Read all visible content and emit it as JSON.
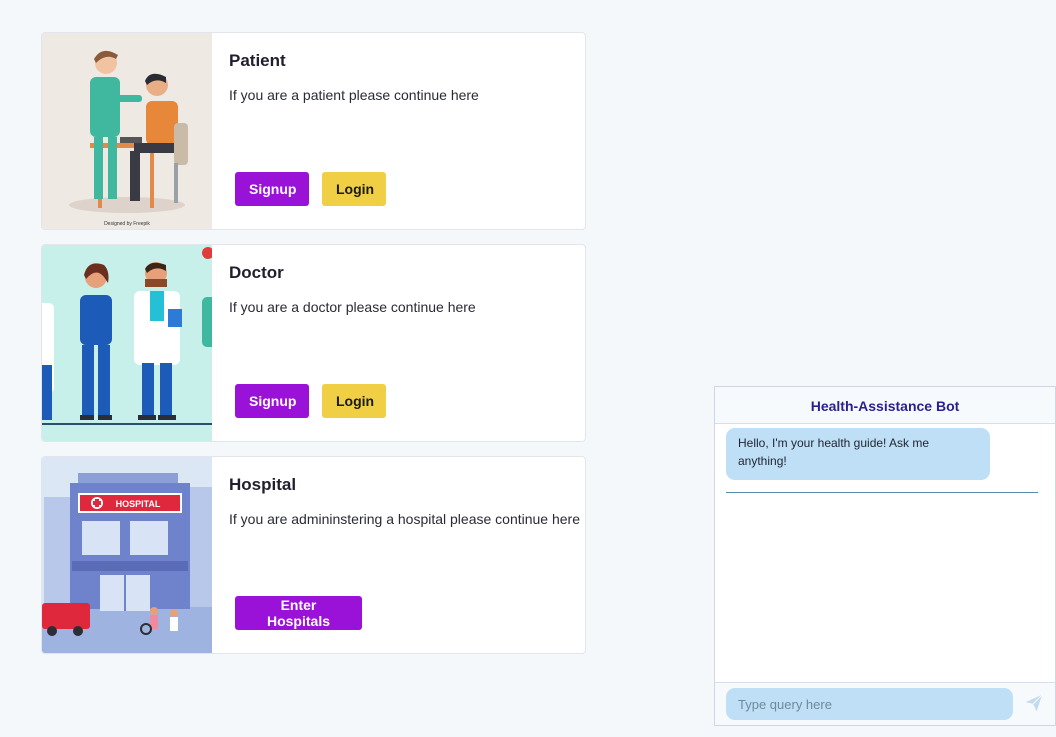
{
  "cards": [
    {
      "title": "Patient",
      "description": "If you are a patient please continue here",
      "buttons": {
        "signup": "Signup",
        "login": "Login"
      },
      "image_credit": "Designed by Freepik"
    },
    {
      "title": "Doctor",
      "description": "If you are a doctor please continue here",
      "buttons": {
        "signup": "Signup",
        "login": "Login"
      }
    },
    {
      "title": "Hospital",
      "description": "If you are admininstering a hospital please continue here",
      "buttons": {
        "enter": "Enter Hospitals"
      },
      "image_sign": "HOSPITAL"
    }
  ],
  "chatbot": {
    "title": "Health-Assistance Bot",
    "messages": [
      {
        "from": "bot",
        "text": "Hello, I'm your health guide! Ask me anything!"
      }
    ],
    "input_placeholder": "Type query here",
    "send_icon": "paper-plane-icon"
  },
  "colors": {
    "primary_button": "#9a12d8",
    "secondary_button": "#f0cf45",
    "chat_bubble": "#bfdff6",
    "bot_title": "#2b1f8f"
  }
}
